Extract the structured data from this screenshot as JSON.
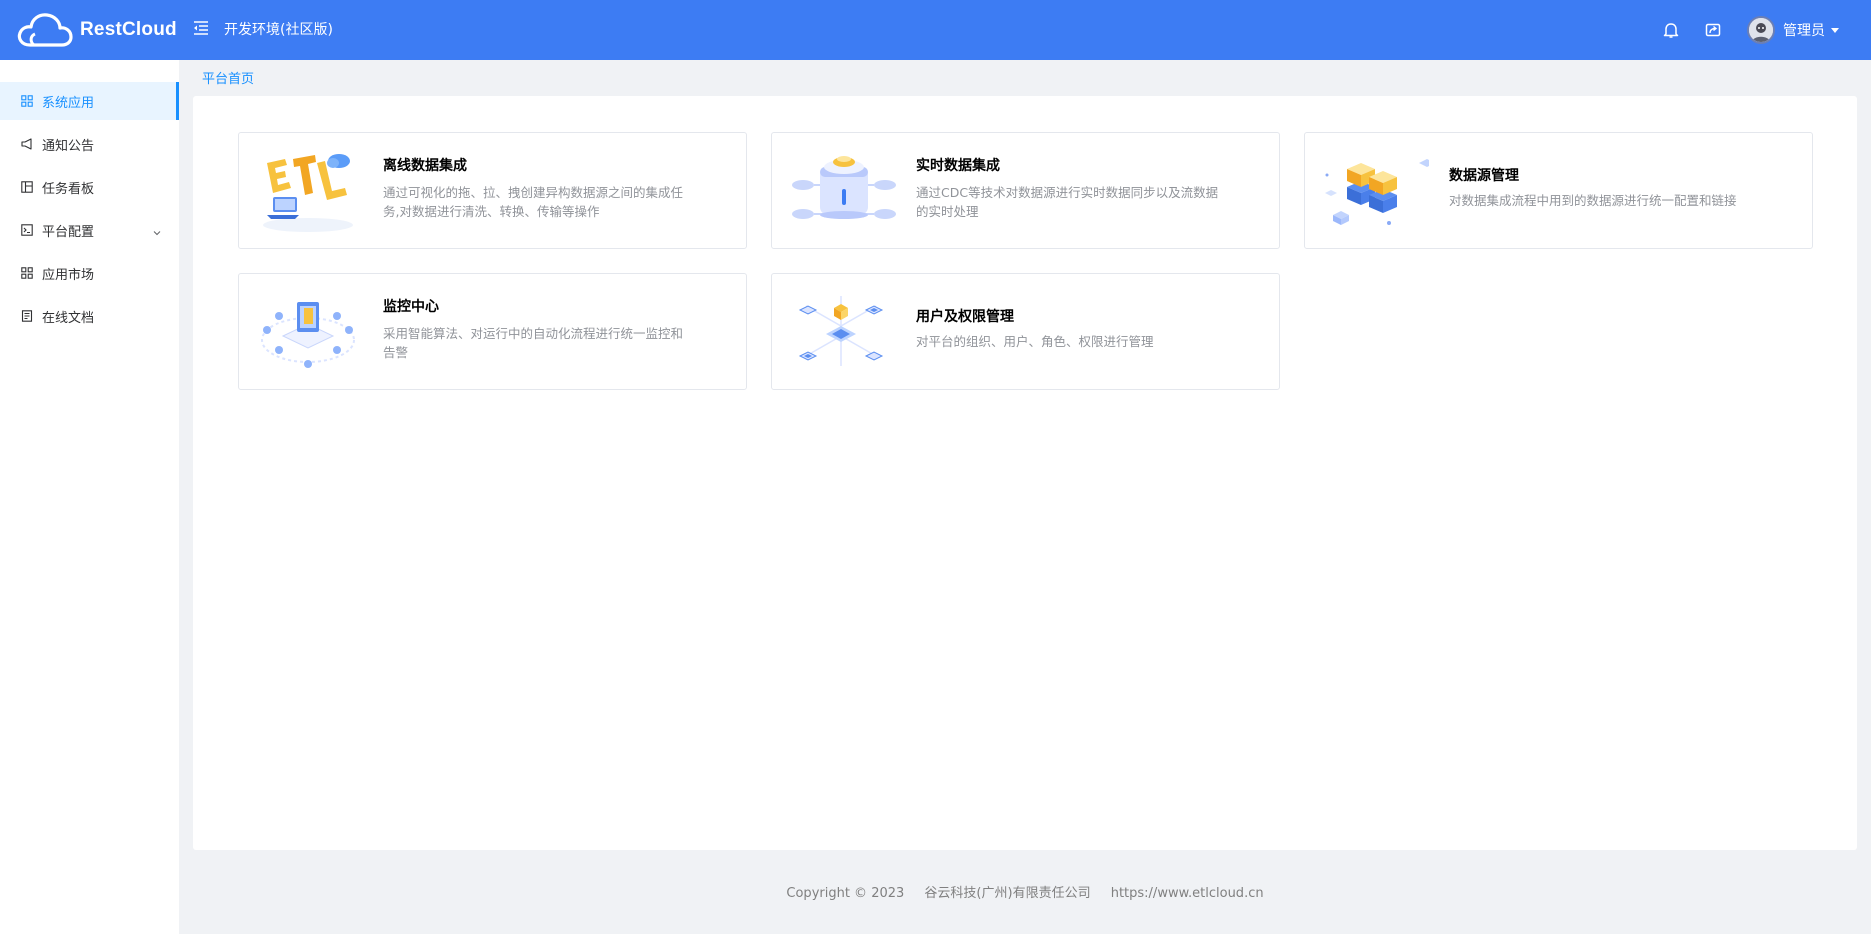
{
  "header": {
    "brand": "RestCloud",
    "env_title": "开发环境(社区版)",
    "user_name": "管理员",
    "icons": [
      "menu-fold-icon",
      "bell-icon",
      "share-icon",
      "avatar"
    ],
    "bg_color": "#3d7cf3"
  },
  "sidebar": {
    "items": [
      {
        "label": "系统应用",
        "icon": "grid-icon",
        "active": true
      },
      {
        "label": "通知公告",
        "icon": "megaphone-icon"
      },
      {
        "label": "任务看板",
        "icon": "board-icon"
      },
      {
        "label": "平台配置",
        "icon": "terminal-icon",
        "has_submenu": true
      },
      {
        "label": "应用市场",
        "icon": "grid-icon"
      },
      {
        "label": "在线文档",
        "icon": "document-icon"
      }
    ],
    "active_color": "#1890ff"
  },
  "breadcrumb": {
    "label": "平台首页"
  },
  "cards": [
    {
      "title": "离线数据集成",
      "desc": "通过可视化的拖、拉、拽创建异构数据源之间的集成任务,对数据进行清洗、转换、传输等操作",
      "icon": "etl-illustration"
    },
    {
      "title": "实时数据集成",
      "desc": "通过CDC等技术对数据源进行实时数据同步以及流数据的实时处理",
      "icon": "realtime-database-illustration"
    },
    {
      "title": "数据源管理",
      "desc": "对数据集成流程中用到的数据源进行统一配置和链接",
      "icon": "datasource-blocks-illustration"
    },
    {
      "title": "监控中心",
      "desc": "采用智能算法、对运行中的自动化流程进行统一监控和告警",
      "icon": "monitor-illustration"
    },
    {
      "title": "用户及权限管理",
      "desc": "对平台的组织、用户、角色、权限进行管理",
      "icon": "user-permission-illustration"
    }
  ],
  "footer": {
    "copyright": "Copyright © 2023",
    "company": "谷云科技(广州)有限责任公司",
    "url": "https://www.etlcloud.cn"
  }
}
